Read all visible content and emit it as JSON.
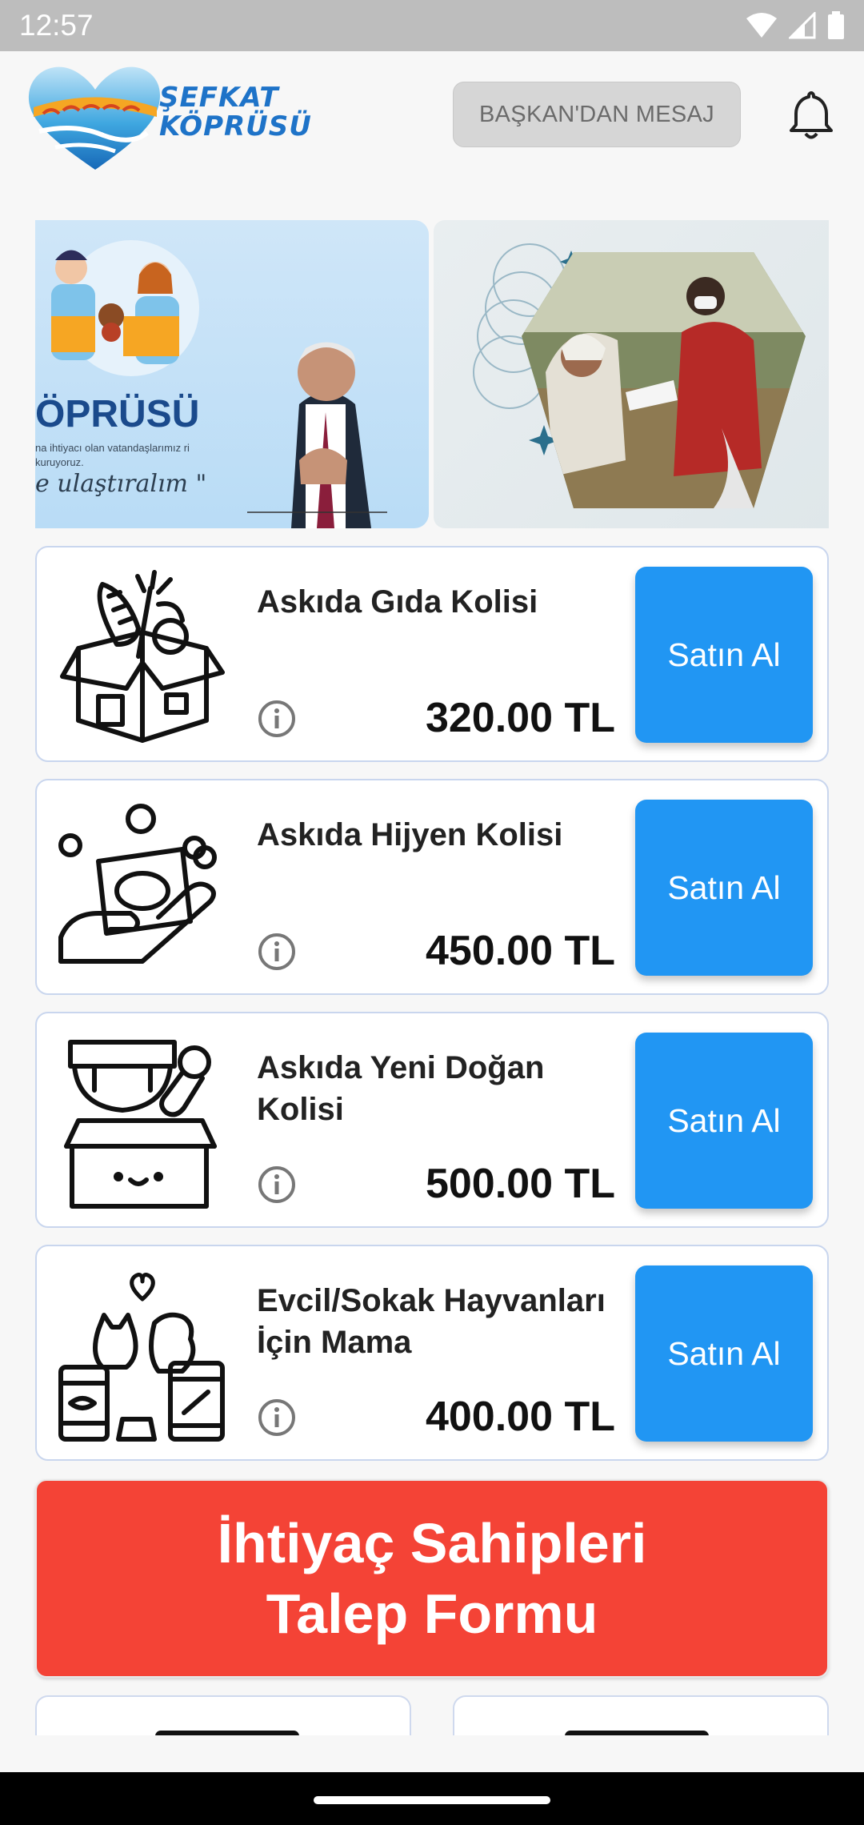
{
  "status_bar": {
    "time": "12:57",
    "icons": [
      "wifi-icon",
      "signal-icon",
      "battery-icon"
    ]
  },
  "header": {
    "logo_line1": "ŞEFKAT",
    "logo_line2": "KÖPRÜSÜ",
    "message_button": "BAŞKAN'DAN MESAJ",
    "notification_icon": "bell-icon"
  },
  "banner": {
    "slide1_title": "ÖPRÜSÜ",
    "slide1_sub": "na ihtiyacı olan vatandaşlarımız ri kuruyoruz.",
    "slide1_script": "e ulaştıralım \""
  },
  "products": [
    {
      "title": "Askıda Gıda Kolisi",
      "price": "320.00 TL",
      "button": "Satın Al",
      "icon": "food-box-icon"
    },
    {
      "title": "Askıda Hijyen Kolisi",
      "price": "450.00 TL",
      "button": "Satın Al",
      "icon": "hygiene-hand-icon"
    },
    {
      "title": "Askıda Yeni Doğan Kolisi",
      "price": "500.00 TL",
      "button": "Satın Al",
      "icon": "newborn-box-icon"
    },
    {
      "title": "Evcil/Sokak Hayvanları İçin Mama",
      "price": "400.00 TL",
      "button": "Satın Al",
      "icon": "pet-food-icon"
    }
  ],
  "request_form": {
    "line1": "İhtiyaç Sahipleri",
    "line2": "Talep Formu"
  },
  "colors": {
    "primary": "#2196f3",
    "danger": "#f44336",
    "status_bar": "#bdbdbd"
  }
}
